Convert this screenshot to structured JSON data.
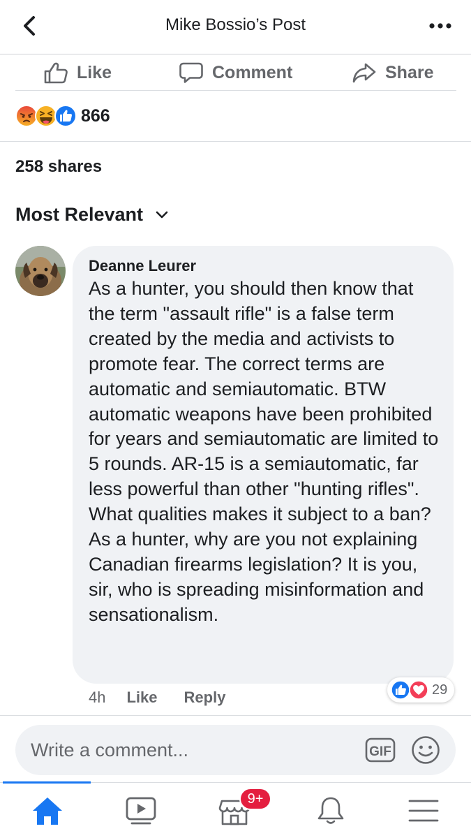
{
  "header": {
    "title": "Mike Bossio’s Post",
    "back_icon": "chevron-left-icon",
    "more_icon": "more-horizontal-icon"
  },
  "actions": {
    "like_label": "Like",
    "comment_label": "Comment",
    "share_label": "Share"
  },
  "reactions": {
    "icons": [
      "angry-icon",
      "haha-icon",
      "like-icon"
    ],
    "count": "866"
  },
  "shares": {
    "label": "258 shares"
  },
  "sort": {
    "label": "Most Relevant"
  },
  "comment": {
    "author": "Deanne Leurer",
    "text": "As a hunter, you should then know that the term \"assault rifle\" is a false term created by the media and activists to promote fear. The correct terms are automatic and semiautomatic. BTW automatic weapons have been prohibited for years and semiautomatic are limited to 5 rounds. AR-15 is a semiautomatic, far less powerful than other \"hunting rifles\". What qualities makes it subject to a ban? As a hunter, why are you not explaining Canadian firearms legislation? It is you, sir, who is spreading misinformation and sensationalism.",
    "time": "4h",
    "like_label": "Like",
    "reply_label": "Reply",
    "reaction_icons": [
      "like-icon",
      "love-icon"
    ],
    "reaction_count": "29"
  },
  "composer": {
    "placeholder": "Write a comment...",
    "gif_label": "GIF"
  },
  "tabbar": {
    "tabs": [
      "home-icon",
      "watch-icon",
      "marketplace-icon",
      "notifications-icon",
      "menu-icon"
    ],
    "marketplace_badge": "9+"
  },
  "colors": {
    "accent": "#1877f2",
    "badge": "#e41e3f",
    "bubble": "#f0f2f5",
    "muted_text": "#65676b",
    "love": "#f33e58",
    "reaction_yellow": "#f7b125"
  }
}
